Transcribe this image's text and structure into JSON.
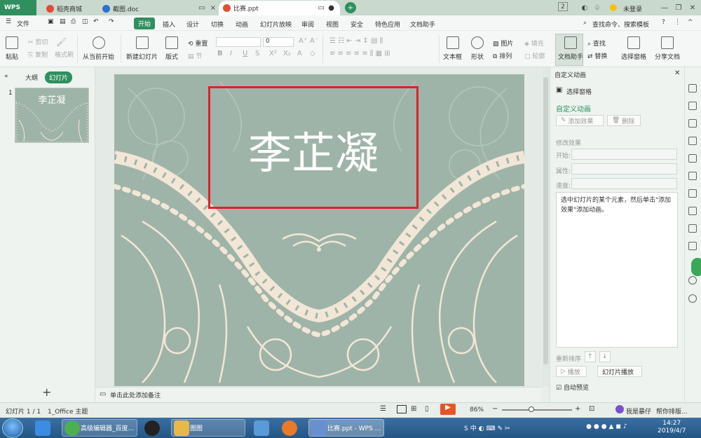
{
  "titlebar": {
    "wps": "WPS",
    "tabs": [
      {
        "label": "稻壳商城"
      },
      {
        "label": "截图.doc"
      },
      {
        "label": "比赛.ppt"
      }
    ],
    "badge": "2",
    "login": "未登录"
  },
  "menu": {
    "file": "文件",
    "items": [
      "开始",
      "插入",
      "设计",
      "切换",
      "动画",
      "幻灯片放映",
      "审阅",
      "视图",
      "安全",
      "特色应用",
      "文档助手"
    ],
    "search": "查找命令、搜索模板"
  },
  "toolbar": {
    "paste": "粘贴",
    "cut": "剪切",
    "copy": "复制",
    "format_painter": "格式刷",
    "play_from_current": "从当前开始",
    "new_slide": "新建幻灯片",
    "layout": "版式",
    "section": "节",
    "reset": "重置",
    "font_size": "0",
    "textbox": "文本框",
    "shape": "形状",
    "picture": "图片",
    "fill": "填充",
    "arrange": "排列",
    "outline": "轮廓",
    "doc_assistant": "文档助手",
    "find": "查找",
    "replace": "替换",
    "select_pane": "选择窗格",
    "share": "分享文档"
  },
  "leftpanel": {
    "outline_tab": "大纲",
    "slides_tab": "幻灯片",
    "slide_number": "1",
    "thumb_title": "李芷凝",
    "add": "+"
  },
  "slide": {
    "title": "李芷凝",
    "background": "#9fb4a8",
    "lace": "#f2e6d6"
  },
  "notes": {
    "placeholder": "单击此处添加备注"
  },
  "pane": {
    "header": "自定义动画",
    "select_pane": "选择窗格",
    "section_title": "自定义动画",
    "add_effect": "添加效果",
    "delete": "删除",
    "modify_effect": "修改效果",
    "start_label": "开始:",
    "property_label": "属性:",
    "speed_label": "速度:",
    "hint": "选中幻灯片的某个元素，然后单击\"添加效果\"添加动画。",
    "reorder": "重新排序",
    "play": "播放",
    "slideshow": "幻灯片播放",
    "autopreview": "自动预览"
  },
  "status": {
    "slide_info": "幻灯片 1 / 1",
    "theme": "1_Office 主题",
    "zoom": "86%",
    "user": "我是暴仔",
    "tip": "帮你排版..."
  },
  "taskbar": {
    "items": [
      {
        "label": "高级编辑器_百度..."
      },
      {
        "label": "图图"
      },
      {
        "label": "比赛.ppt - WPS ..."
      }
    ],
    "time": "14:27",
    "date": "2019/4/7"
  },
  "colors": {
    "accent": "#2f8f5f",
    "selection": "#e0202a",
    "taskbar": "#2a5d8f"
  }
}
